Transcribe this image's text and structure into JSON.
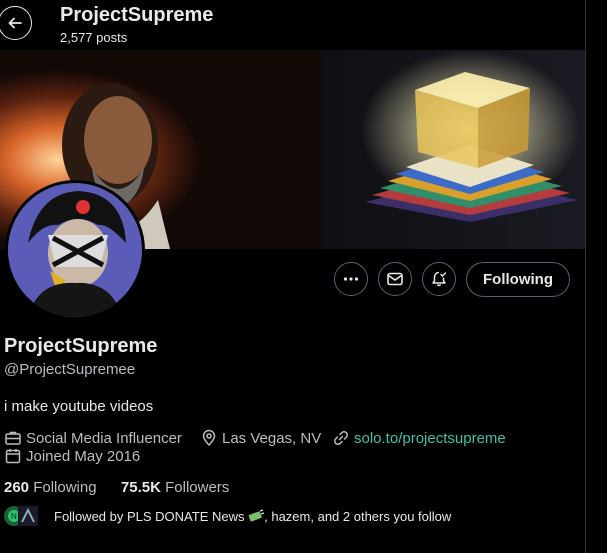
{
  "header": {
    "title": "ProjectSupreme",
    "posts_count": "2,577 posts"
  },
  "actions": {
    "following_label": "Following"
  },
  "profile": {
    "display_name": "ProjectSupreme",
    "handle": "@ProjectSupremee",
    "bio": "i make youtube videos",
    "category": "Social Media Influencer",
    "location": "Las Vegas, NV",
    "link": "solo.to/projectsupreme",
    "joined": "Joined May 2016"
  },
  "stats": {
    "following_count": "260",
    "following_label": "Following",
    "followers_count": "75.5K",
    "followers_label": "Followers"
  },
  "followed_by": {
    "text_prefix": "Followed by PLS DONATE News",
    "text_suffix": ", hazem, and 2 others you follow"
  },
  "colors": {
    "background": "#000000",
    "text_primary": "#e7e9ea",
    "text_secondary": "#b9bec3",
    "link": "#3fc2a6"
  }
}
